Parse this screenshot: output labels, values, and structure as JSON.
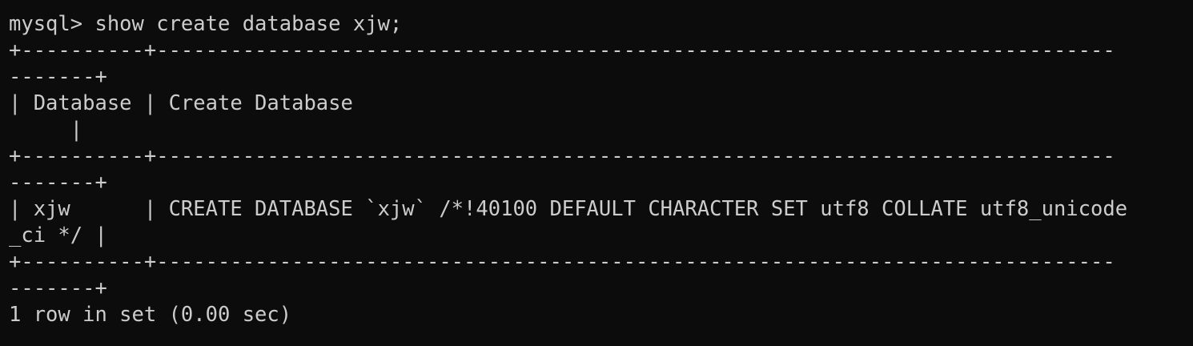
{
  "terminal": {
    "lines": [
      "mysql> show create database xjw;",
      "+----------+------------------------------------------------------------------------------",
      "-------+",
      "| Database | Create Database",
      "     |",
      "+----------+------------------------------------------------------------------------------",
      "-------+",
      "| xjw      | CREATE DATABASE `xjw` /*!40100 DEFAULT CHARACTER SET utf8 COLLATE utf8_unicode",
      "_ci */ |",
      "+----------+------------------------------------------------------------------------------",
      "-------+",
      "1 row in set (0.00 sec)"
    ]
  }
}
